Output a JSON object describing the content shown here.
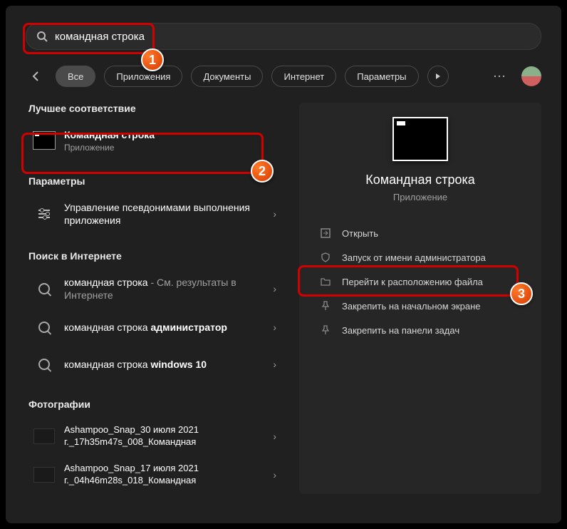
{
  "search": {
    "value": "командная строка"
  },
  "filters": {
    "0": {
      "label": "Все"
    },
    "1": {
      "label": "Приложения"
    },
    "2": {
      "label": "Документы"
    },
    "3": {
      "label": "Интернет"
    },
    "4": {
      "label": "Параметры"
    }
  },
  "sections": {
    "best_match": "Лучшее соответствие",
    "settings": "Параметры",
    "web": "Поиск в Интернете",
    "photos": "Фотографии"
  },
  "best": {
    "title": "Командная строка",
    "sub": "Приложение"
  },
  "settings_item": {
    "title": "Управление псевдонимами выполнения приложения"
  },
  "web_items": {
    "0": {
      "pre": "командная строка",
      "suf": " - См. результаты в Интернете"
    },
    "1": {
      "pre": "командная строка ",
      "bold": "администратор"
    },
    "2": {
      "pre": "командная строка ",
      "bold": "windows 10"
    }
  },
  "photos": {
    "0": {
      "title": "Ashampoo_Snap_30 июля 2021 г._17h35m47s_008_Командная"
    },
    "1": {
      "title": "Ashampoo_Snap_17 июля 2021 г._04h46m28s_018_Командная"
    }
  },
  "detail": {
    "name": "Командная строка",
    "type": "Приложение"
  },
  "actions": {
    "open": "Открыть",
    "admin": "Запуск от имени администратора",
    "location": "Перейти к расположению файла",
    "pin_start": "Закрепить на начальном экране",
    "pin_taskbar": "Закрепить на панели задач"
  },
  "annotations": {
    "1": "1",
    "2": "2",
    "3": "3"
  }
}
